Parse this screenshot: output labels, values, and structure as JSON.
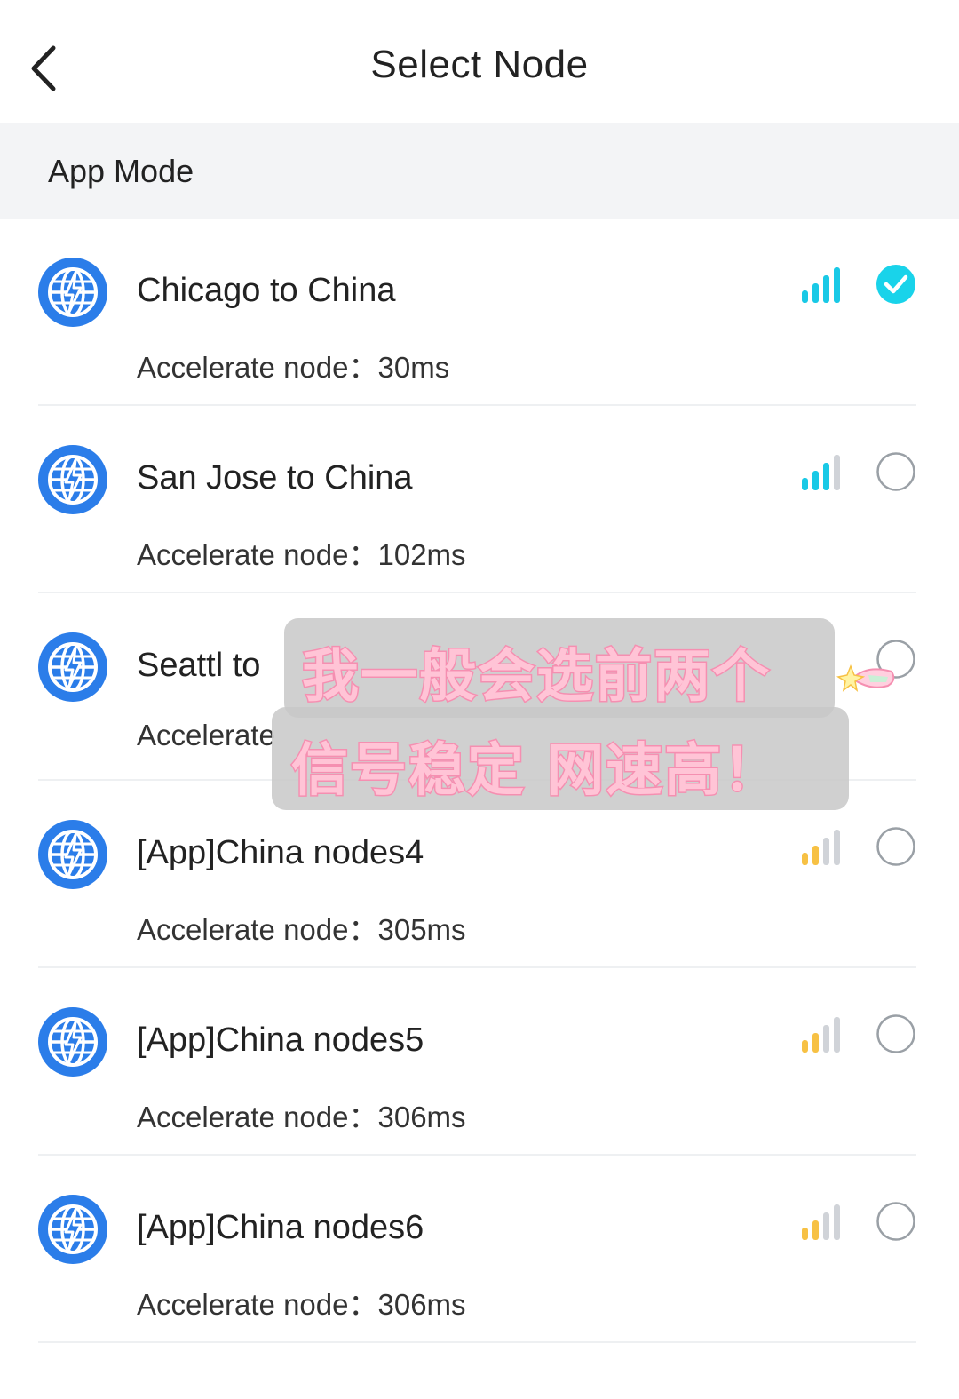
{
  "header": {
    "title": "Select Node",
    "back_icon": "chevron-left-icon"
  },
  "section": {
    "label": "App Mode"
  },
  "colors": {
    "accent": "#19d3ea",
    "globe": "#2b7de9",
    "signal_good": "#19c9e6",
    "signal_weak": "#f7c144",
    "signal_inactive": "#d0d3d8",
    "radio_border": "#9aa0a6",
    "section_bg": "#f3f4f6",
    "sticker_fill": "#ffc4d6",
    "sticker_stroke": "#f58fb1"
  },
  "nodes": [
    {
      "name": "Chicago to China",
      "latency_label": "Accelerate node：30ms",
      "signal_level": 4,
      "signal_color": "good",
      "selected": true
    },
    {
      "name": "San Jose to China",
      "latency_label": "Accelerate node：102ms",
      "signal_level": 3,
      "signal_color": "good",
      "selected": false
    },
    {
      "name": "Seattl to",
      "latency_label": "Accelerate",
      "signal_level": 0,
      "signal_color": "good",
      "selected": false
    },
    {
      "name": "[App]China nodes4",
      "latency_label": "Accelerate node：305ms",
      "signal_level": 2,
      "signal_color": "weak",
      "selected": false
    },
    {
      "name": "[App]China nodes5",
      "latency_label": "Accelerate node：306ms",
      "signal_level": 2,
      "signal_color": "weak",
      "selected": false
    },
    {
      "name": "[App]China nodes6",
      "latency_label": "Accelerate node：306ms",
      "signal_level": 2,
      "signal_color": "weak",
      "selected": false
    }
  ],
  "sticker": {
    "line1": "我一般会选前两个",
    "line2": "信号稳定 网速高！"
  }
}
